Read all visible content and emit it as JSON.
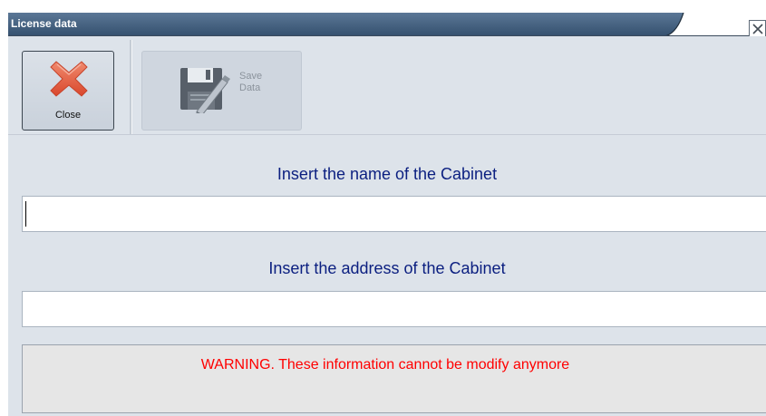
{
  "window": {
    "title": "License data"
  },
  "toolbar": {
    "close_label": "Close",
    "save_label_line1": "Save",
    "save_label_line2": "Data"
  },
  "form": {
    "name_heading": "Insert the name of the Cabinet",
    "name_value": "",
    "address_heading": "Insert the address of the Cabinet",
    "address_value": "",
    "warning": "WARNING. These information cannot be modify anymore"
  },
  "icons": {
    "close": "close-x-icon",
    "save": "floppy-disk-pen-icon",
    "window_close": "window-close-icon"
  },
  "colors": {
    "title_bar": "#3f5a78",
    "heading_text": "#0b1f80",
    "warning_text": "#ff0000",
    "close_icon": "#e2593d"
  }
}
